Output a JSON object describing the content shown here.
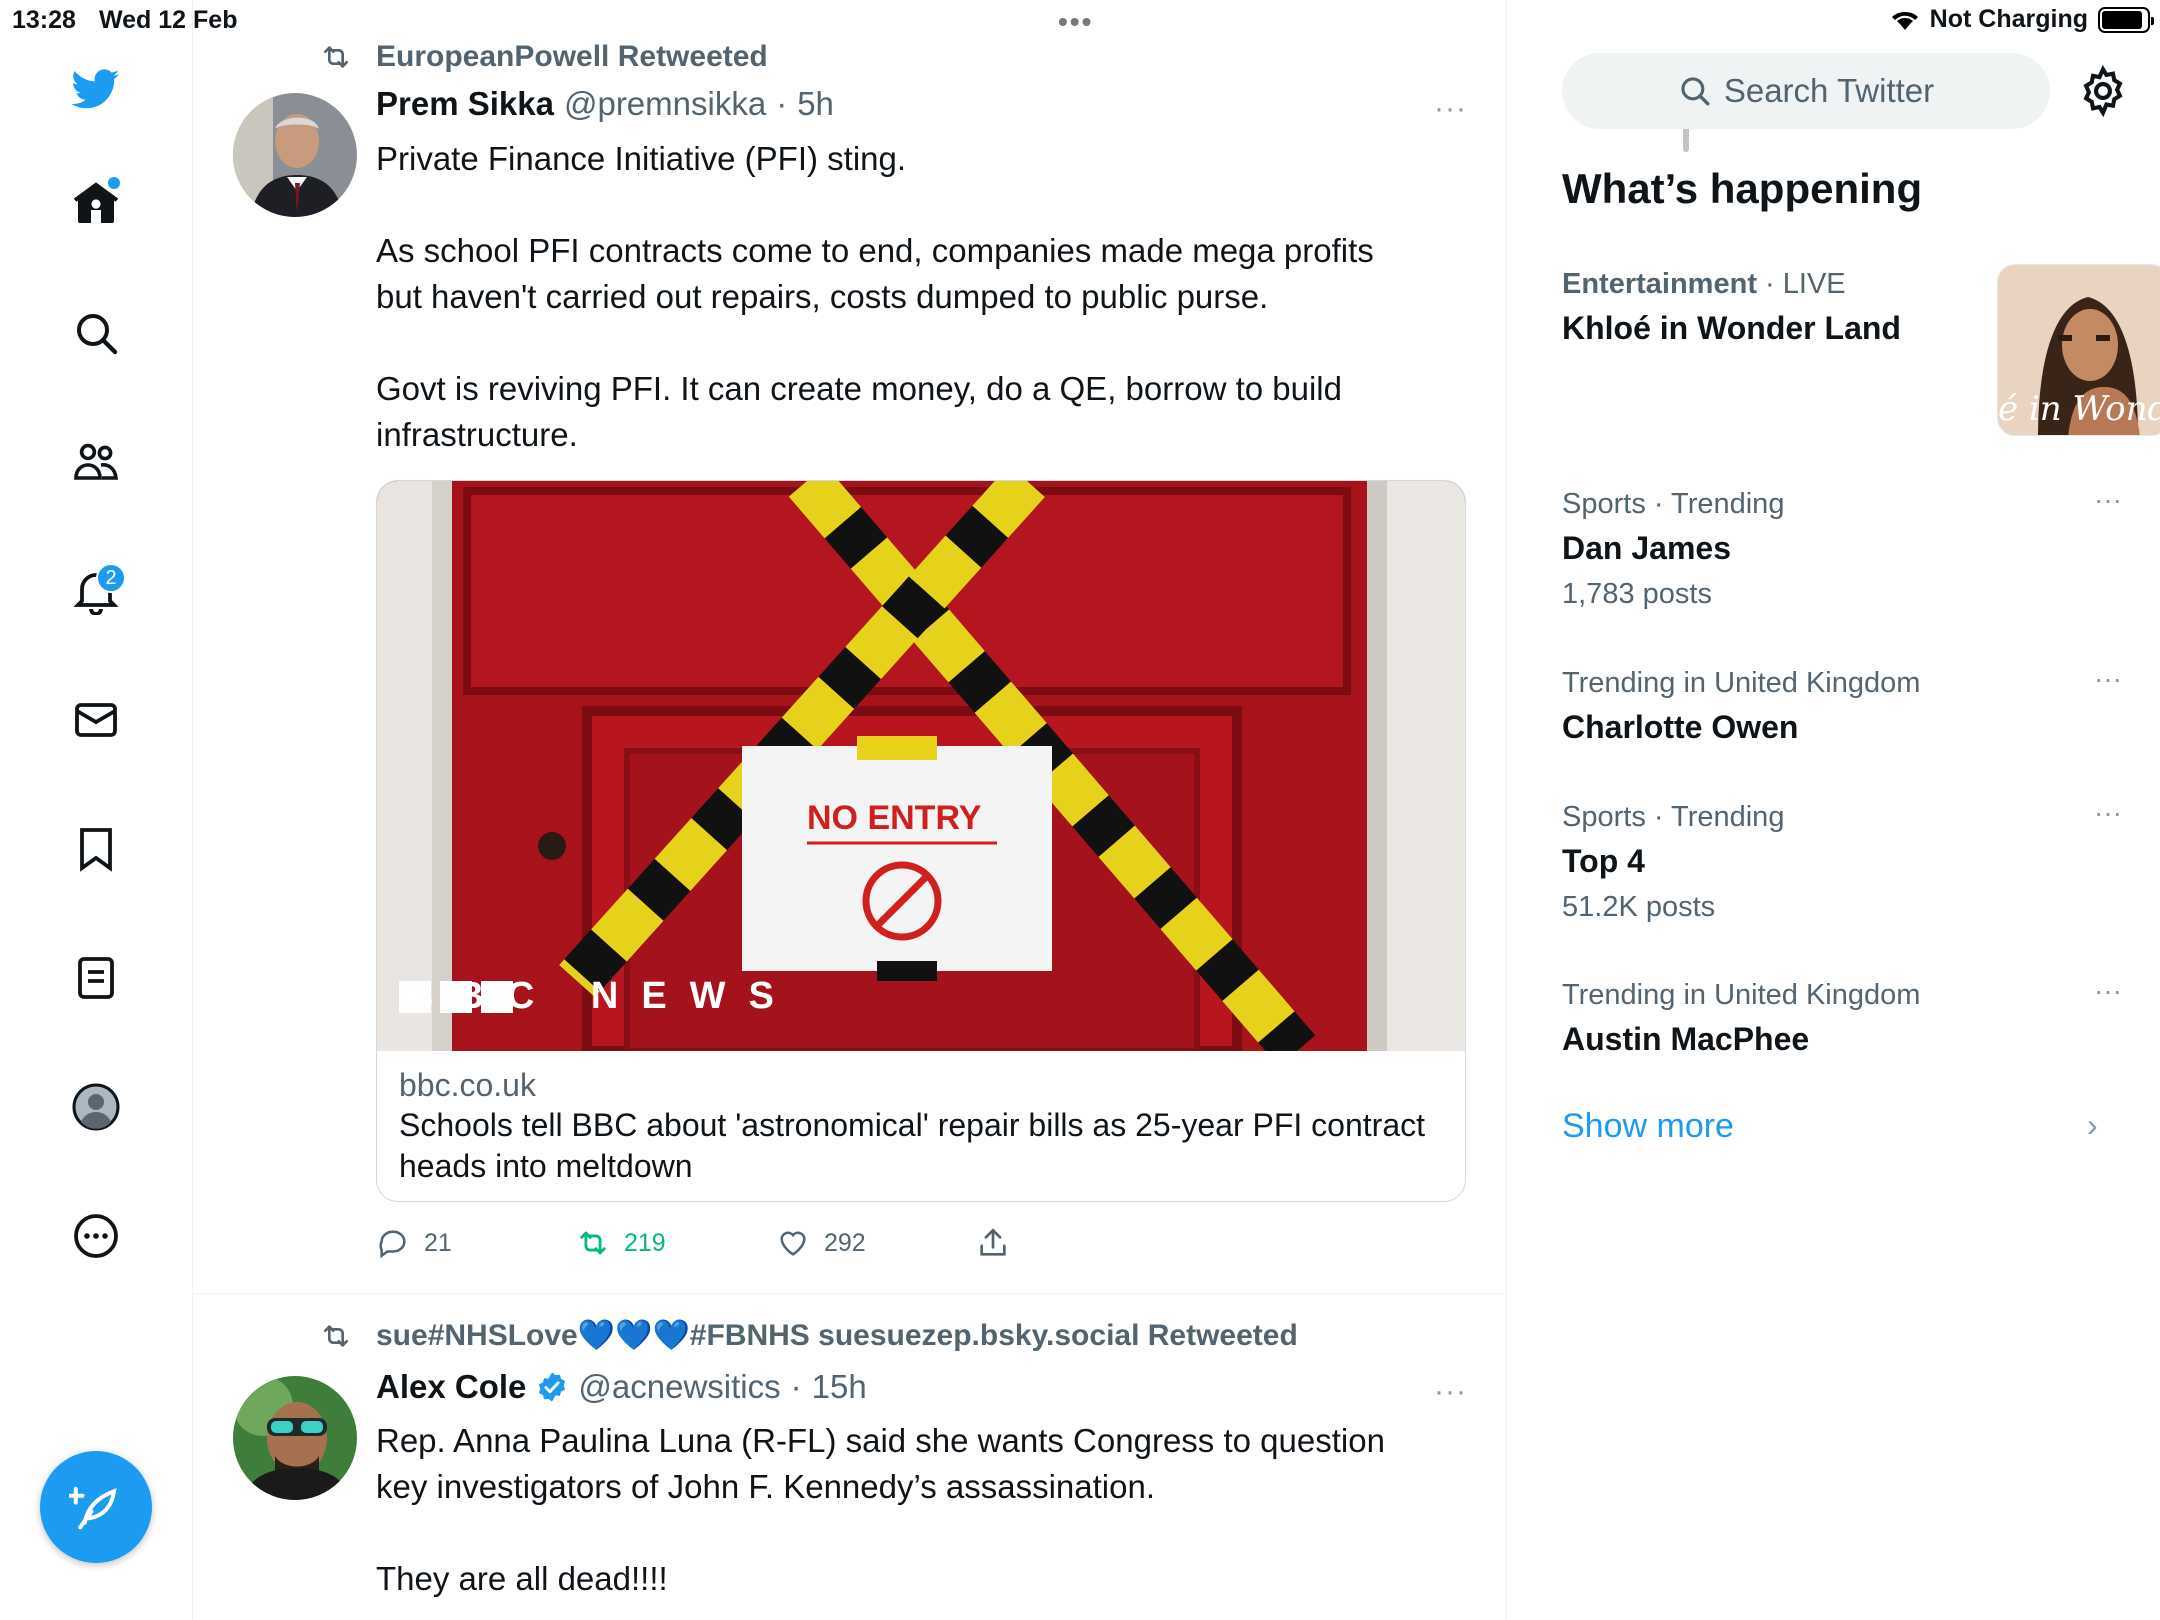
{
  "status_bar": {
    "time": "13:28",
    "date": "Wed 12 Feb",
    "charging": "Not Charging",
    "battery_level": 0.9
  },
  "nav": {
    "notifications_badge": "2"
  },
  "timeline": {
    "tweets": [
      {
        "retweeted_by": "EuropeanPowell Retweeted",
        "name": "Prem Sikka",
        "handle": "@premnsikka",
        "time": "5h",
        "more": "···",
        "text": "Private Finance Initiative (PFI) sting.\n\nAs school PFI contracts come to end, companies made mega profits but haven't carried out repairs, costs dumped to public purse.\n\nGovt is reviving PFI. It can create money, do a QE, borrow to build infrastructure.",
        "card": {
          "image_sign": "NO ENTRY",
          "image_logo": "BBC NEWS",
          "domain": "bbc.co.uk",
          "title": "Schools tell BBC about 'astronomical' repair bills as 25-year PFI contract heads into meltdown"
        },
        "replies": "21",
        "retweets": "219",
        "likes": "292"
      },
      {
        "retweeted_by": "sue#NHSLove💙💙💙#FBNHS suesuezep.bsky.social Retweeted",
        "name": "Alex Cole",
        "handle": "@acnewsitics",
        "time": "15h",
        "more": "···",
        "text": "Rep. Anna Paulina Luna (R-FL) said she wants Congress to question key investigators of John F. Kennedy’s assassination.\n\nThey are all dead!!!!"
      }
    ]
  },
  "sidebar": {
    "search_placeholder": "Search Twitter",
    "section_title": "What’s happening",
    "trends": [
      {
        "category": "Entertainment",
        "context": "LIVE",
        "name": "Khloé in Wonder Land",
        "image_text": "é in Wonder l"
      },
      {
        "category": "Sports · Trending",
        "name": "Dan James",
        "count": "1,783 posts"
      },
      {
        "category": "Trending in United Kingdom",
        "name": "Charlotte Owen"
      },
      {
        "category": "Sports · Trending",
        "name": "Top 4",
        "count": "51.2K posts"
      },
      {
        "category": "Trending in United Kingdom",
        "name": "Austin MacPhee"
      }
    ],
    "show_more": "Show more"
  },
  "colors": {
    "accent": "#1d9bf0",
    "retweet_green": "#00ba7c",
    "muted": "#536471"
  }
}
